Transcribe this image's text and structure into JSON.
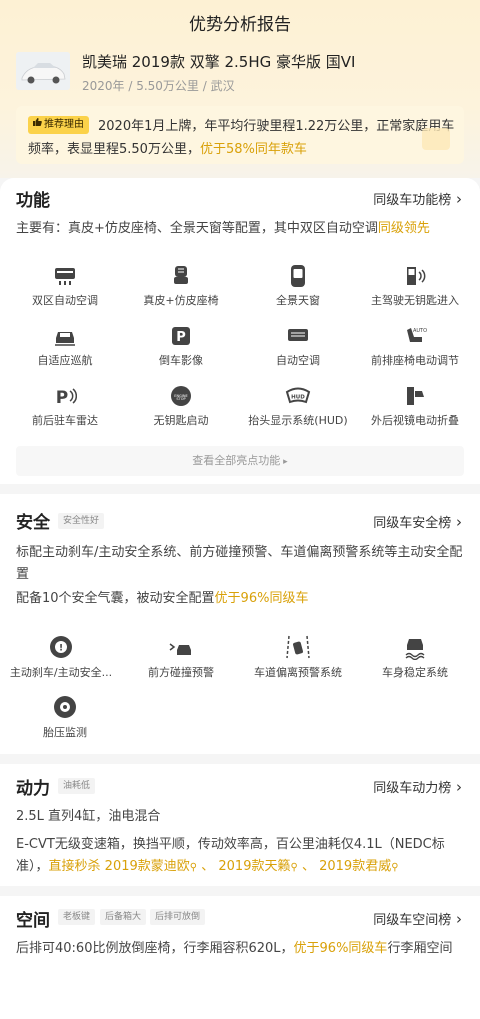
{
  "header": {
    "title": "优势分析报告"
  },
  "car": {
    "name": "凯美瑞 2019款 双擎 2.5HG 豪华版 国VI",
    "meta": "2020年 / 5.50万公里 / 武汉"
  },
  "recommend": {
    "badge": "推荐理由",
    "text": "2020年1月上牌，年平均行驶里程1.22万公里，正常家庭用车频率，表显里程5.50万公里，",
    "highlight": "优于58%同年款车"
  },
  "function": {
    "title": "功能",
    "link": "同级车功能榜",
    "summary_prefix": "主要有：真皮+仿皮座椅、全景天窗等配置，其中双区自动空调",
    "summary_highlight": "同级领先",
    "items": [
      {
        "label": "双区自动空调",
        "icon": "dual-zone-ac-icon"
      },
      {
        "label": "真皮+仿皮座椅",
        "icon": "leather-seat-icon"
      },
      {
        "label": "全景天窗",
        "icon": "panoramic-sunroof-icon"
      },
      {
        "label": "主驾驶无钥匙进入",
        "icon": "keyless-entry-icon"
      },
      {
        "label": "自适应巡航",
        "icon": "adaptive-cruise-icon"
      },
      {
        "label": "倒车影像",
        "icon": "reverse-camera-icon"
      },
      {
        "label": "自动空调",
        "icon": "auto-ac-icon"
      },
      {
        "label": "前排座椅电动调节",
        "icon": "power-seat-icon"
      },
      {
        "label": "前后驻车雷达",
        "icon": "parking-radar-icon"
      },
      {
        "label": "无钥匙启动",
        "icon": "push-start-icon"
      },
      {
        "label": "抬头显示系统(HUD)",
        "icon": "hud-icon"
      },
      {
        "label": "外后视镜电动折叠",
        "icon": "mirror-fold-icon"
      }
    ],
    "view_all": "查看全部亮点功能"
  },
  "safety": {
    "title": "安全",
    "tag": "安全性好",
    "link": "同级车安全榜",
    "line1": "标配主动刹车/主动安全系统、前方碰撞预警、车道偏离预警系统等主动安全配置",
    "line2_prefix": "配备10个安全气囊，被动安全配置",
    "line2_highlight": "优于96%同级车",
    "items": [
      {
        "label": "主动刹车/主动安全...",
        "icon": "active-brake-icon"
      },
      {
        "label": "前方碰撞预警",
        "icon": "collision-warning-icon"
      },
      {
        "label": "车道偏离预警系统",
        "icon": "lane-departure-icon"
      },
      {
        "label": "车身稳定系统",
        "icon": "stability-control-icon"
      },
      {
        "label": "胎压监测",
        "icon": "tire-pressure-icon"
      }
    ]
  },
  "power": {
    "title": "动力",
    "tag": "油耗低",
    "link": "同级车动力榜",
    "line1": "2.5L 直列4缸，油电混合",
    "line2": "E-CVT无级变速箱，换挡平顺，传动效率高，百公里油耗仅4.1L（NEDC标准），",
    "line2_highlight": "直接秒杀",
    "cars": [
      "2019款蒙迪欧",
      "2019款天籁",
      "2019款君威"
    ],
    "sep": "、"
  },
  "space": {
    "title": "空间",
    "tags": [
      "老板键",
      "后备箱大",
      "后排可放倒"
    ],
    "link": "同级车空间榜",
    "line_prefix": "后排可40:60比例放倒座椅，行李厢容积620L，",
    "line_highlight": "优于96%同级车",
    "line_suffix": "行李厢空间"
  },
  "colors": {
    "accent": "#d9a10a",
    "badge": "#fbd24a",
    "icon": "#444444"
  }
}
